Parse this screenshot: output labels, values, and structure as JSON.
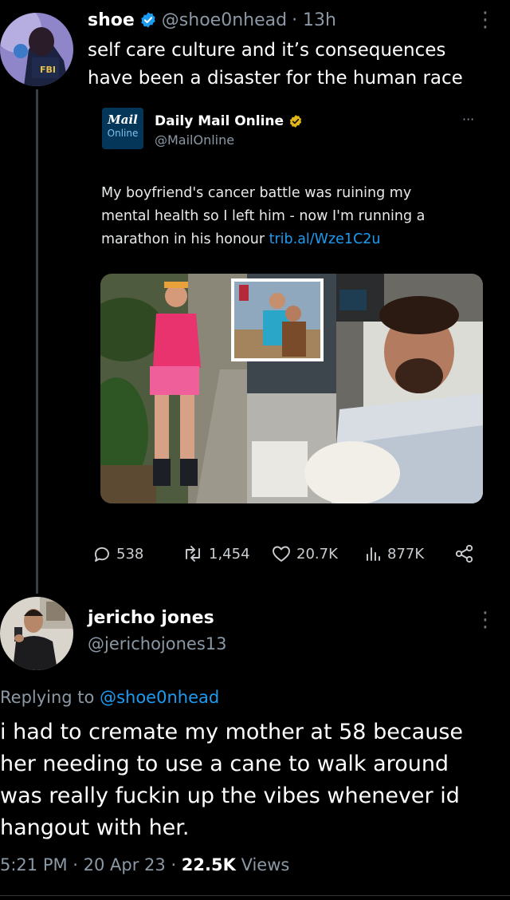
{
  "tweet": {
    "display_name": "shoe",
    "handle": "@shoe0nhead",
    "time_ago": "· 13h",
    "text_line1": "self care culture and it’s consequences",
    "text_line2": "have been a disaster for the human race",
    "avatar_badge": "FBI"
  },
  "quoted": {
    "logo_top": "Mail",
    "logo_bottom": "Online",
    "display_name": "Daily Mail Online",
    "handle": "@MailOnline",
    "more": "···",
    "text_line1": "My boyfriend's cancer battle was ruining my",
    "text_line2": "mental health so I left him - now I'm running a",
    "text_line3_prefix": "marathon in his honour ",
    "link": "trib.al/Wze1C2u"
  },
  "stats": {
    "replies": "538",
    "retweets": "1,454",
    "likes": "20.7K",
    "views": "877K"
  },
  "reply": {
    "display_name": "jericho jones",
    "handle": "@jerichojones13",
    "replying_prefix": "Replying to ",
    "replying_handle": "@shoe0nhead",
    "text_line1": "i had to cremate my mother at 58 because",
    "text_line2": "her needing to use a cane to walk around",
    "text_line3": "was really fuckin up the vibes whenever id",
    "text_line4": "hangout with her.",
    "time": "5:21 PM · 20 Apr 23 · ",
    "views_count": "22.5K",
    "views_label": " Views"
  },
  "colors": {
    "background": "#000000",
    "text": "#e7e9ea",
    "muted": "#8b98a5",
    "link": "#1d9bf0",
    "verified_blue": "#1d9bf0",
    "verified_gold": "#e2b719"
  }
}
